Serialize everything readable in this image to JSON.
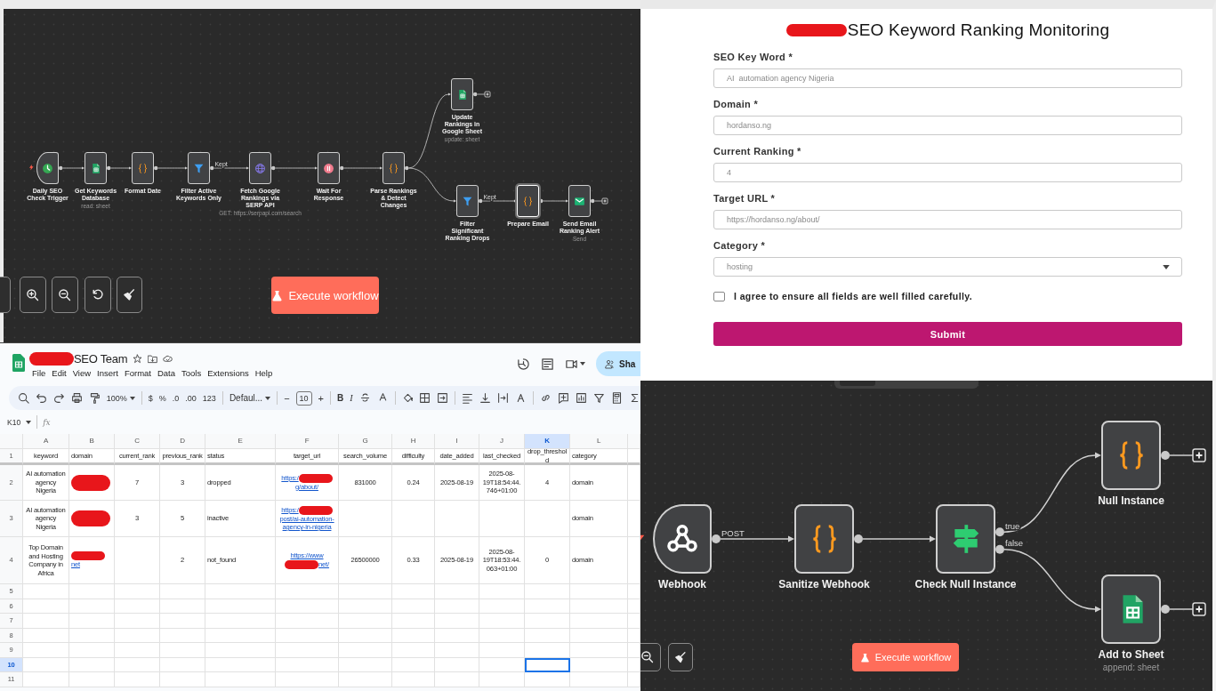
{
  "top_workflow": {
    "nodes": [
      {
        "label": "Daily SEO Check Trigger",
        "kind": "schedule",
        "selected": false,
        "add_button": false
      },
      {
        "label": "Get Keywords Database",
        "subtitle": "read: sheet",
        "kind": "sheets",
        "selected": false,
        "add_button": false
      },
      {
        "label": "Format Date",
        "kind": "code",
        "selected": false,
        "add_button": false
      },
      {
        "label": "Filter Active Keywords Only",
        "kind": "filter",
        "outputs": [
          "Kept"
        ],
        "selected": false,
        "add_button": false
      },
      {
        "label": "Fetch Google Rankings via SERP API",
        "subtitle": "GET: https://serpapi.com/search",
        "kind": "http",
        "selected": false,
        "add_button": false
      },
      {
        "label": "Wait For Response",
        "kind": "wait",
        "selected": false,
        "add_button": false
      },
      {
        "label": "Parse Rankings & Detect Changes",
        "kind": "code",
        "selected": false,
        "add_button": false
      },
      {
        "label": "Update Rankings in Google Sheet",
        "subtitle": "update: sheet",
        "kind": "sheets",
        "selected": false,
        "add_button": true
      },
      {
        "label": "Filter Significant Ranking Drops",
        "kind": "filter",
        "outputs": [
          "Kept"
        ],
        "selected": false,
        "add_button": false
      },
      {
        "label": "Prepare Email",
        "kind": "code",
        "selected": true,
        "add_button": false
      },
      {
        "label": "Send Email Ranking Alert",
        "subtitle": "Send",
        "kind": "email",
        "selected": false,
        "add_button": true
      }
    ],
    "execute_button": "Execute workflow"
  },
  "form": {
    "title": "SEO Keyword Ranking Monitoring",
    "fields": [
      {
        "label": "SEO Key Word *",
        "value": "AI  automation agency Nigeria",
        "kind": "text"
      },
      {
        "label": "Domain *",
        "value": "hordanso.ng",
        "kind": "text"
      },
      {
        "label": "Current Ranking *",
        "value": "4",
        "kind": "text"
      },
      {
        "label": "Target URL  *",
        "value": "https://hordanso.ng/about/",
        "kind": "text"
      },
      {
        "label": "Category *",
        "value": "hosting",
        "kind": "select"
      }
    ],
    "consent": {
      "label": "I agree to ensure all fields are well filled carefully.",
      "checked": false
    },
    "submit": "Submit"
  },
  "spreadsheet": {
    "title": "SEO Team",
    "menu": [
      "File",
      "Edit",
      "View",
      "Insert",
      "Format",
      "Data",
      "Tools",
      "Extensions",
      "Help"
    ],
    "share": "Sha",
    "toolbar": {
      "zoom": "100%",
      "currency": "$",
      "percent": "%",
      "decrease_decimal": ".0",
      "increase_decimal": ".00",
      "number_format": "123",
      "font": "Defaul...",
      "minus": "−",
      "font_size": "10",
      "plus": "+",
      "bold": "B",
      "italic": "I"
    },
    "name_box": "K10",
    "formula_icon": "fx",
    "columns": [
      {
        "label": "A",
        "selected": false
      },
      {
        "label": "B",
        "selected": false
      },
      {
        "label": "C",
        "selected": false
      },
      {
        "label": "D",
        "selected": false
      },
      {
        "label": "E",
        "selected": false
      },
      {
        "label": "F",
        "selected": false
      },
      {
        "label": "G",
        "selected": false
      },
      {
        "label": "H",
        "selected": false
      },
      {
        "label": "I",
        "selected": false
      },
      {
        "label": "J",
        "selected": false
      },
      {
        "label": "K",
        "selected": true
      },
      {
        "label": "L",
        "selected": false
      }
    ],
    "rows": [
      {
        "number": "1",
        "selected": false,
        "cells": {
          "A": "keyword",
          "B": "domain",
          "C": "current_rank",
          "D": "previous_rank",
          "E": "status",
          "F": "target_url",
          "G": "search_volume",
          "H": "difficulty",
          "I": "date_added",
          "J": "last_checked",
          "K": "drop_threshold",
          "L": "category"
        }
      },
      {
        "number": "2",
        "selected": false,
        "cells": {
          "A": "AI automation agency Nigeria",
          "B": {
            "parts": [
              {
                "kind": "redaction"
              }
            ]
          },
          "C": "7",
          "D": "3",
          "E": "dropped",
          "F": {
            "link": true,
            "parts": [
              {
                "kind": "text",
                "text": "https:/"
              },
              {
                "kind": "redaction"
              },
              {
                "kind": "text",
                "text": "g/about/"
              }
            ]
          },
          "G": "831000",
          "H": "0.24",
          "I": "2025-08-19",
          "J": "2025-08-19T18:54:44.746+01:00",
          "K": "4",
          "L": "domain"
        }
      },
      {
        "number": "3",
        "selected": false,
        "cells": {
          "A": "AI automation agency Nigeria",
          "B": {
            "parts": [
              {
                "kind": "redaction"
              }
            ]
          },
          "C": "3",
          "D": "5",
          "E": "inactive",
          "F": {
            "link": true,
            "parts": [
              {
                "kind": "text",
                "text": "https:/"
              },
              {
                "kind": "redaction"
              },
              {
                "kind": "text",
                "text": "post/ai-automation-agency-in-nigeria"
              }
            ]
          },
          "L": "domain"
        }
      },
      {
        "number": "4",
        "selected": false,
        "cells": {
          "A": "Top Domain and Hosting Company in Africa",
          "B": {
            "link": true,
            "parts": [
              {
                "kind": "redaction"
              },
              {
                "kind": "text",
                "text": "net"
              }
            ]
          },
          "D": "2",
          "E": "not_found",
          "F": {
            "link": true,
            "parts": [
              {
                "kind": "text",
                "text": "https://www"
              },
              {
                "kind": "redaction"
              },
              {
                "kind": "text",
                "text": "net/"
              }
            ]
          },
          "G": "26500000",
          "H": "0.33",
          "I": "2025-08-19",
          "J": "2025-08-19T18:53:44.063+01:00",
          "K": "0",
          "L": "domain"
        }
      },
      {
        "number": "5",
        "selected": false
      },
      {
        "number": "6",
        "selected": false
      },
      {
        "number": "7",
        "selected": false
      },
      {
        "number": "8",
        "selected": false
      },
      {
        "number": "9",
        "selected": false
      },
      {
        "number": "10",
        "selected": true
      },
      {
        "number": "11",
        "selected": false
      }
    ]
  },
  "bottom_workflow": {
    "nodes": [
      {
        "label": "Webhook",
        "kind": "webhook",
        "outputs": [
          "POST"
        ],
        "selected": false,
        "add_button": false
      },
      {
        "label": "Sanitize Webhook",
        "kind": "code",
        "selected": false,
        "add_button": false
      },
      {
        "label": "Check Null Instance",
        "kind": "if",
        "outputs": [
          "true",
          "false"
        ],
        "selected": false,
        "add_button": false
      },
      {
        "label": "Null Instance",
        "kind": "code",
        "selected": false,
        "add_button": true
      },
      {
        "label": "Add to Sheet",
        "subtitle": "append: sheet",
        "kind": "sheets",
        "selected": false,
        "add_button": true
      }
    ],
    "execute_button": "Execute workflow"
  }
}
